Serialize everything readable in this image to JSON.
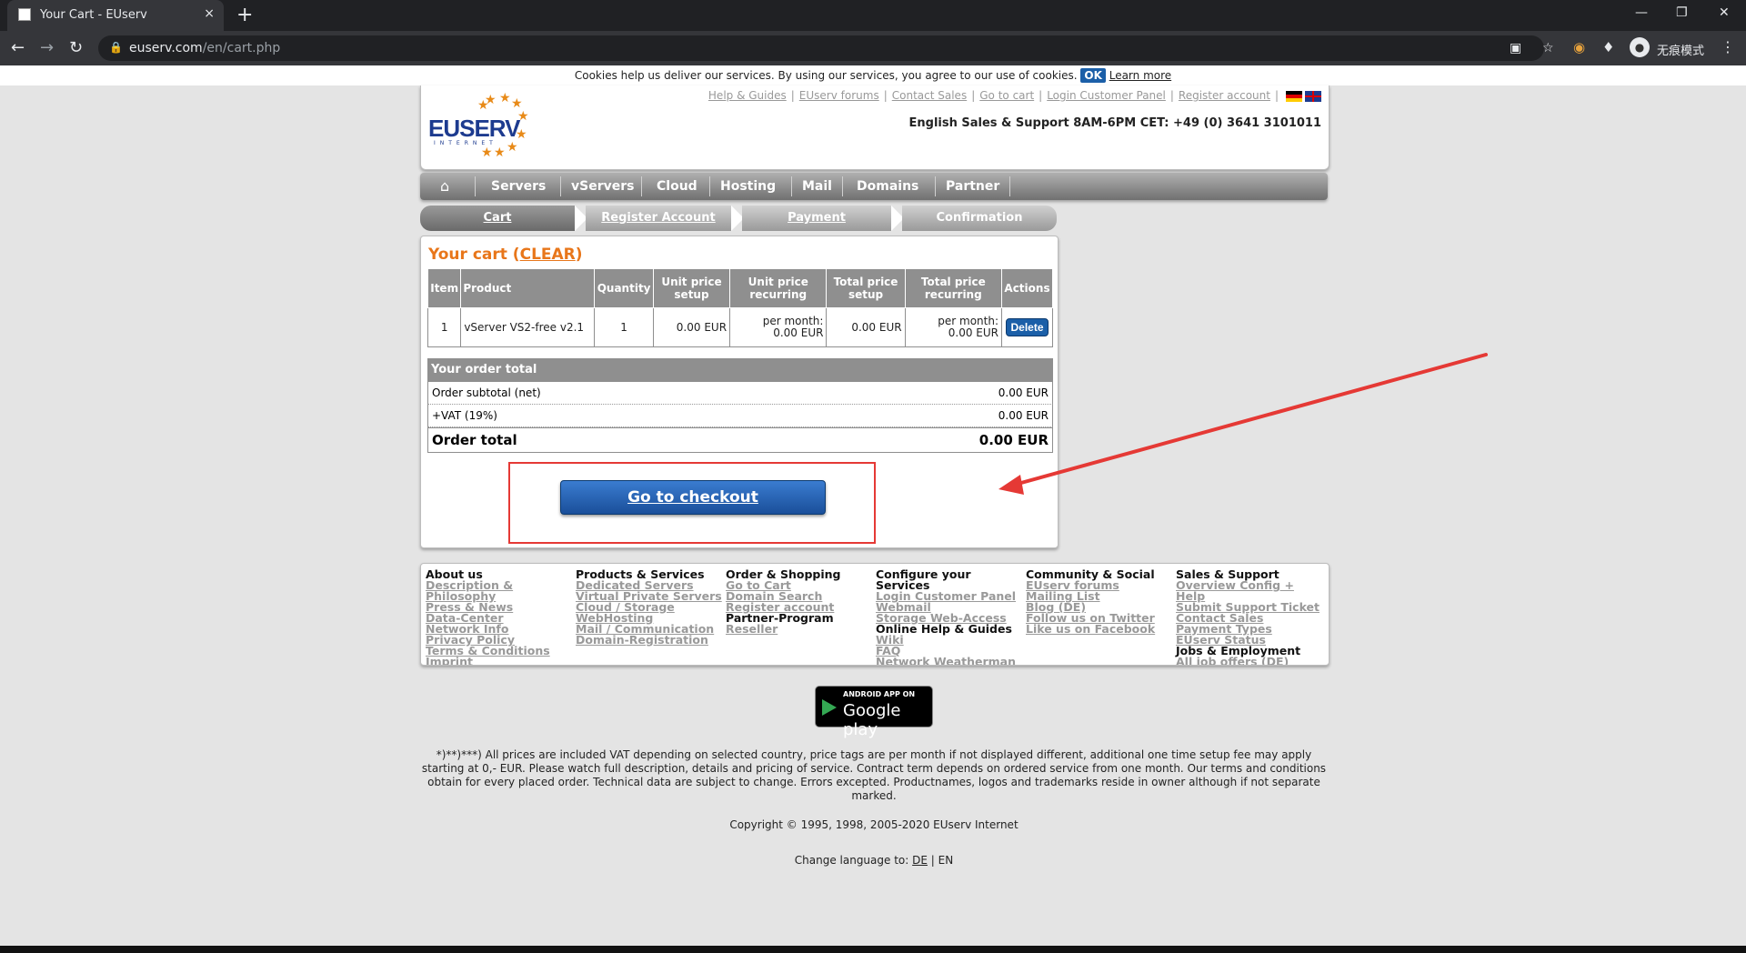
{
  "browser": {
    "tab_title": "Your Cart - EUserv",
    "tab_close": "×",
    "new_tab": "+",
    "url_domain": "euserv.com",
    "url_path": "/en/cart.php",
    "profile_label": "无痕模式"
  },
  "cookie": {
    "text": "Cookies help us deliver our services. By using our services, you agree to our use of cookies.",
    "ok": "OK",
    "learn_more": "Learn more"
  },
  "header": {
    "logo_text": "EUSERV",
    "logo_sub": "INTERNET",
    "links": [
      "Help & Guides",
      "EUserv forums",
      "Contact Sales",
      "Go to cart",
      "Login Customer Panel",
      "Register account"
    ],
    "support": "English Sales & Support 8AM-6PM CET: +49 (0) 3641 3101011"
  },
  "nav": {
    "items": [
      "Servers",
      "vServers",
      "Cloud",
      "Hosting",
      "Mail",
      "Domains",
      "Partner"
    ]
  },
  "steps": [
    "Cart",
    "Register Account",
    "Payment",
    "Confirmation"
  ],
  "cart": {
    "title": "Your cart (",
    "clear": "CLEAR",
    "title_end": ")",
    "headers": [
      "Item",
      "Product",
      "Quantity",
      "Unit price setup",
      "Unit price recurring",
      "Total price setup",
      "Total price recurring",
      "Actions"
    ],
    "row": {
      "item": "1",
      "product": "vServer VS2-free v2.1",
      "quantity": "1",
      "unit_setup": "0.00 EUR",
      "unit_recurring_label": "per month:",
      "unit_recurring": "0.00 EUR",
      "total_setup": "0.00 EUR",
      "total_recurring_label": "per month:",
      "total_recurring": "0.00 EUR",
      "action": "Delete"
    },
    "order_total_head": "Your order total",
    "subtotal_label": "Order subtotal (net)",
    "subtotal_value": "0.00 EUR",
    "vat_label": "+VAT (19%)",
    "vat_value": "0.00 EUR",
    "total_label": "Order total",
    "total_value": "0.00 EUR",
    "checkout": "Go to checkout"
  },
  "footer": {
    "cols": [
      {
        "head": "About us",
        "links": [
          "Description &",
          "Philosophy",
          "Press & News",
          "Data-Center",
          "Network Info",
          "Privacy Policy",
          "Terms & Conditions",
          "Imprint"
        ]
      },
      {
        "head": "Products & Services",
        "links": [
          "Dedicated Servers",
          "Virtual Private Servers",
          "Cloud / Storage",
          "WebHosting",
          "Mail / Communication",
          "Domain-Registration"
        ]
      },
      {
        "head": "Order & Shopping",
        "links": [
          "Go to Cart",
          "Domain Search",
          "Register account"
        ],
        "sub": "Partner-Program",
        "sub_links": [
          "Reseller"
        ]
      },
      {
        "head": "Configure your",
        "head2": "Services",
        "links": [
          "Login Customer Panel",
          "Webmail",
          "Storage Web-Access"
        ],
        "sub": "Online Help & Guides",
        "sub_links": [
          "Wiki",
          "FAQ",
          "Network Weatherman"
        ]
      },
      {
        "head": "Community & Social",
        "links": [
          "EUserv forums",
          "Mailing List",
          "Blog (DE)",
          "Follow us on Twitter",
          "Like us on Facebook"
        ]
      },
      {
        "head": "Sales & Support",
        "links": [
          "Overview Config +",
          "Help",
          "Submit Support Ticket",
          "Contact Sales",
          "Payment Types",
          "EUserv Status"
        ],
        "sub": "Jobs & Employment",
        "sub_links": [
          "All job offers (DE)"
        ]
      }
    ]
  },
  "gplay": {
    "small": "ANDROID APP ON",
    "big": "Google play"
  },
  "disclaimer": "*)**)***) All prices are included VAT depending on selected country, price tags are per month if not displayed different, additional one time setup fee may apply starting at 0,- EUR. Please watch full description, details and pricing of service. Contract term depends on ordered service from one month. Our terms and conditions obtain for every placed order. Technical data are subject to change. Errors excepted. Productnames, logos and trademarks reside in owner although if not separate marked.",
  "copyright": "Copyright © 1995, 1998, 2005-2020 EUserv Internet",
  "language": {
    "label": "Change language to:",
    "de": "DE",
    "sep": "|",
    "en": "EN"
  },
  "annotation_color": "#e53935"
}
